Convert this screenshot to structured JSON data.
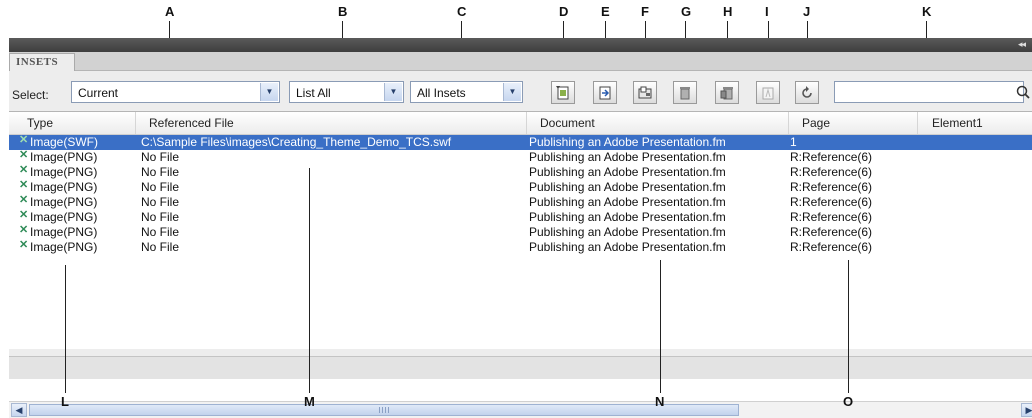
{
  "callouts": {
    "top": [
      "A",
      "B",
      "C",
      "D",
      "E",
      "F",
      "G",
      "H",
      "I",
      "J",
      "K"
    ],
    "bottom": [
      "L",
      "M",
      "N",
      "O"
    ]
  },
  "panel": {
    "tab_label": "INSETS",
    "collapse_glyph": "◂◂",
    "select_label": "Select:",
    "scope_dropdown": {
      "value": "Current"
    },
    "list_dropdown": {
      "value": "List All"
    },
    "type_dropdown": {
      "value": "All Insets"
    },
    "search": {
      "value": "",
      "placeholder": ""
    }
  },
  "toolbar_buttons": [
    "insert-inset-icon",
    "import-inset-icon",
    "update-inset-icon",
    "delete-inset-icon",
    "delete-all-insets-icon",
    "edit-inset-icon",
    "refresh-icon"
  ],
  "table": {
    "columns": [
      "Type",
      "Referenced File",
      "Document",
      "Page",
      "Element1"
    ],
    "rows": [
      {
        "type": "Image(SWF)",
        "file": "C:\\Sample Files\\images\\Creating_Theme_Demo_TCS.swf",
        "document": "Publishing an Adobe Presentation.fm",
        "page": "1",
        "element": "",
        "selected": true
      },
      {
        "type": "Image(PNG)",
        "file": "No File",
        "document": "Publishing an Adobe Presentation.fm",
        "page": "R:Reference(6)",
        "element": "",
        "selected": false
      },
      {
        "type": "Image(PNG)",
        "file": "No File",
        "document": "Publishing an Adobe Presentation.fm",
        "page": "R:Reference(6)",
        "element": "",
        "selected": false
      },
      {
        "type": "Image(PNG)",
        "file": "No File",
        "document": "Publishing an Adobe Presentation.fm",
        "page": "R:Reference(6)",
        "element": "",
        "selected": false
      },
      {
        "type": "Image(PNG)",
        "file": "No File",
        "document": "Publishing an Adobe Presentation.fm",
        "page": "R:Reference(6)",
        "element": "",
        "selected": false
      },
      {
        "type": "Image(PNG)",
        "file": "No File",
        "document": "Publishing an Adobe Presentation.fm",
        "page": "R:Reference(6)",
        "element": "",
        "selected": false
      },
      {
        "type": "Image(PNG)",
        "file": "No File",
        "document": "Publishing an Adobe Presentation.fm",
        "page": "R:Reference(6)",
        "element": "",
        "selected": false
      },
      {
        "type": "Image(PNG)",
        "file": "No File",
        "document": "Publishing an Adobe Presentation.fm",
        "page": "R:Reference(6)",
        "element": "",
        "selected": false
      }
    ]
  },
  "colors": {
    "selection": "#3a6fc6",
    "titlebar": "#4a4a4a",
    "panel": "#ededed"
  }
}
